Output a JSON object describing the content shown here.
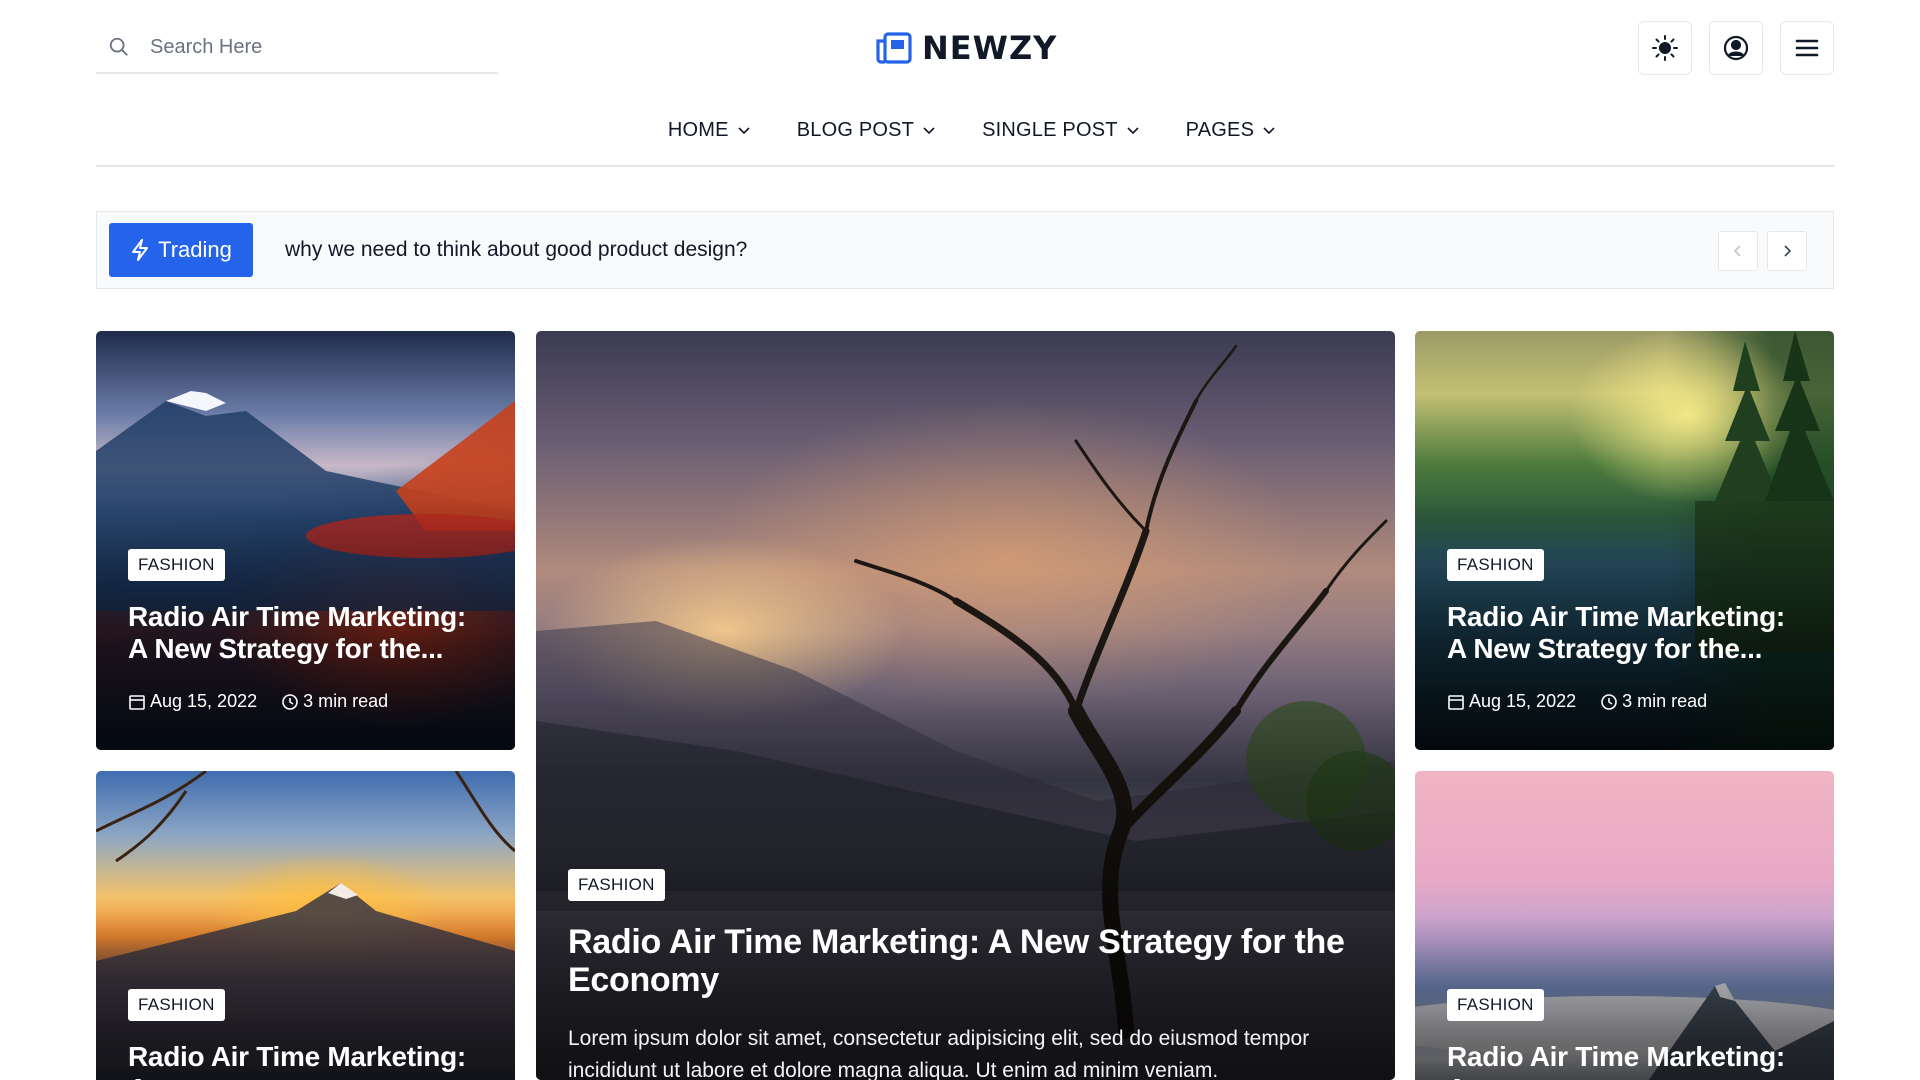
{
  "header": {
    "search_placeholder": "Search Here",
    "logo_text": "NEWZY",
    "accent_color": "#2563eb"
  },
  "nav": {
    "items": [
      {
        "label": "HOME"
      },
      {
        "label": "BLOG POST"
      },
      {
        "label": "SINGLE POST"
      },
      {
        "label": "PAGES"
      }
    ]
  },
  "ticker": {
    "badge": "Trading",
    "headline": "why we need to think about good product design?"
  },
  "cards": [
    {
      "tag": "FASHION",
      "title": "Radio Air Time Marketing: A New Strategy for the...",
      "date": "Aug 15, 2022",
      "read_time": "3 min read"
    },
    {
      "tag": "FASHION",
      "title": "Radio Air Time Marketing: A New Strategy for the Economy",
      "excerpt": "Lorem ipsum dolor sit amet, consectetur adipisicing elit, sed do eiusmod tempor incididunt ut labore et dolore magna aliqua. Ut enim ad minim veniam."
    },
    {
      "tag": "FASHION",
      "title": "Radio Air Time Marketing: A New Strategy for the...",
      "date": "Aug 15, 2022",
      "read_time": "3 min read"
    },
    {
      "tag": "FASHION",
      "title": "Radio Air Time Marketing: A"
    },
    {
      "tag": "FASHION",
      "title": "Radio Air Time Marketing: A"
    }
  ]
}
